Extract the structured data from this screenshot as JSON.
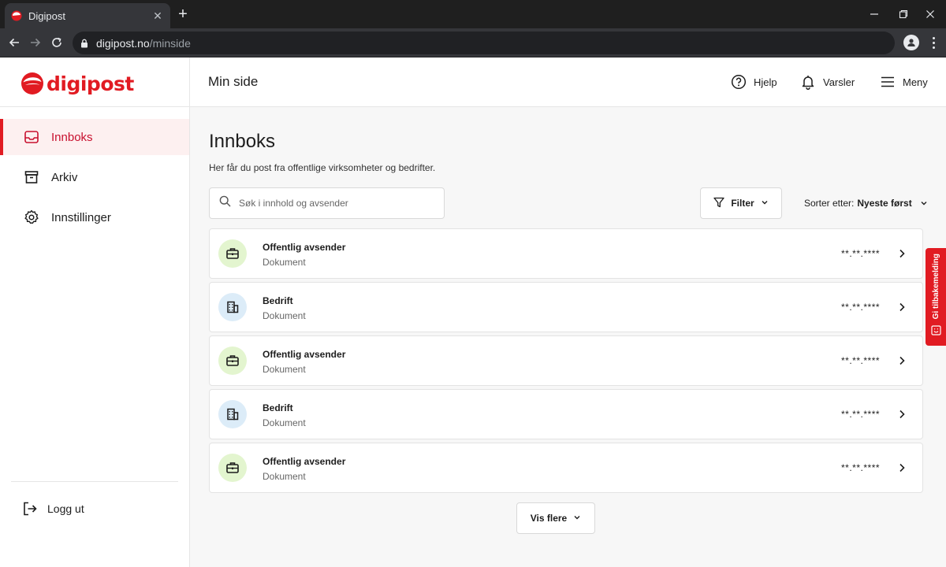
{
  "browser": {
    "tab_title": "Digipost",
    "url_domain": "digipost.no",
    "url_path": "/minside"
  },
  "app": {
    "logo_text": "digipost",
    "brand_color": "#e11b22"
  },
  "header": {
    "page_title": "Min side",
    "help_label": "Hjelp",
    "alerts_label": "Varsler",
    "menu_label": "Meny"
  },
  "sidebar": {
    "items": [
      {
        "label": "Innboks",
        "icon": "inbox-icon",
        "active": true
      },
      {
        "label": "Arkiv",
        "icon": "archive-icon",
        "active": false
      },
      {
        "label": "Innstillinger",
        "icon": "gear-icon",
        "active": false
      }
    ],
    "logout_label": "Logg ut"
  },
  "main": {
    "title": "Innboks",
    "subtitle": "Her får du post fra offentlige virksomheter og bedrifter.",
    "search_placeholder": "Søk i innhold og avsender",
    "filter_label": "Filter",
    "sort_prefix": "Sorter etter:",
    "sort_value": "Nyeste først",
    "show_more_label": "Vis flere",
    "messages": [
      {
        "sender": "Offentlig avsender",
        "type": "Dokument",
        "date": "**.**.****",
        "icon": "briefcase-icon"
      },
      {
        "sender": "Bedrift",
        "type": "Dokument",
        "date": "**.**.****",
        "icon": "building-icon"
      },
      {
        "sender": "Offentlig avsender",
        "type": "Dokument",
        "date": "**.**.****",
        "icon": "briefcase-icon"
      },
      {
        "sender": "Bedrift",
        "type": "Dokument",
        "date": "**.**.****",
        "icon": "building-icon"
      },
      {
        "sender": "Offentlig avsender",
        "type": "Dokument",
        "date": "**.**.****",
        "icon": "briefcase-icon"
      }
    ]
  },
  "feedback": {
    "label": "Gi tilbakemelding"
  }
}
